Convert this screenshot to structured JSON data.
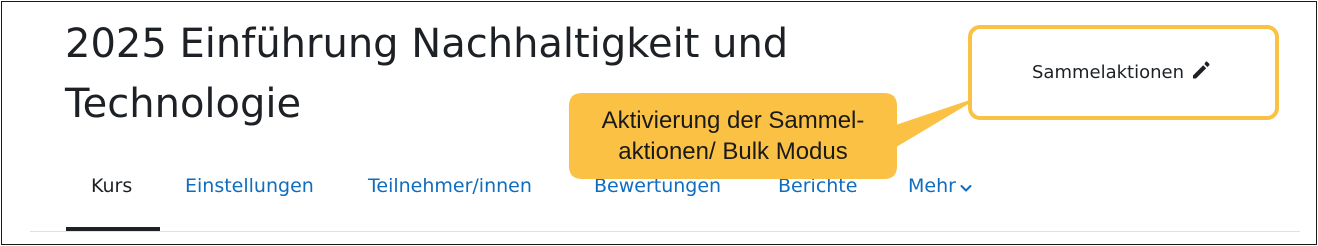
{
  "course": {
    "title": "2025 Einführung Nachhaltigkeit und Technologie"
  },
  "nav": {
    "tabs": [
      {
        "label": "Kurs",
        "active": true
      },
      {
        "label": "Einstellungen",
        "active": false
      },
      {
        "label": "Teilnehmer/innen",
        "active": false
      },
      {
        "label": "Bewertungen",
        "active": false
      },
      {
        "label": "Berichte",
        "active": false
      },
      {
        "label": "Mehr",
        "active": false
      }
    ],
    "more_icon": "chevron-down-icon"
  },
  "bulk": {
    "label": "Sammelaktionen",
    "icon": "pencil-icon"
  },
  "callout": {
    "line1": "Aktivierung der Sammel-",
    "line2": "aktionen/ Bulk Modus"
  },
  "colors": {
    "link": "#0f6cbf",
    "text": "#1d2125",
    "highlight": "#fbc145"
  }
}
